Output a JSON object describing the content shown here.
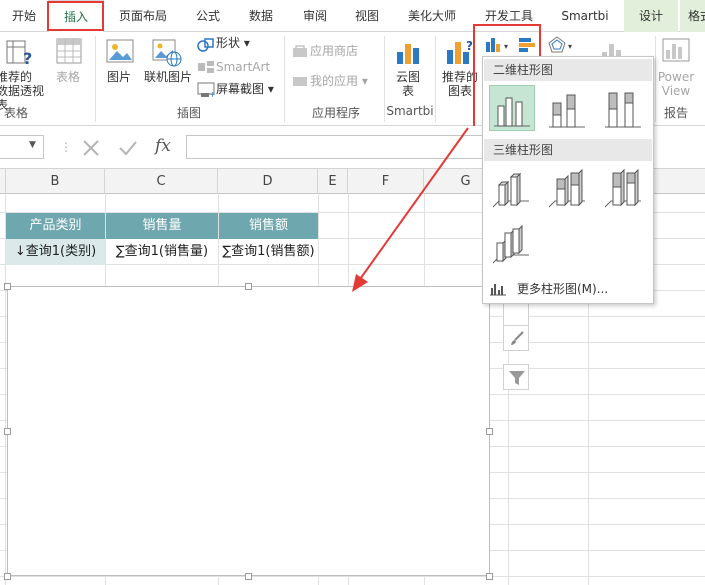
{
  "ribbon_tabs": [
    "开始",
    "插入",
    "页面布局",
    "公式",
    "数据",
    "审阅",
    "视图",
    "美化大师",
    "开发工具",
    "Smartbi",
    "设计",
    "格式"
  ],
  "active_tab": "插入",
  "ribbon": {
    "pivot_recommend": "推荐的\n数据透视表",
    "table": "表格",
    "group_tables": "表格",
    "picture": "图片",
    "online_picture": "联机图片",
    "shapes": "形状",
    "smartart": "SmartArt",
    "screenshot": "屏幕截图",
    "group_illustrations": "插图",
    "app_store": "应用商店",
    "my_apps": "我的应用",
    "group_apps": "应用程序",
    "cloud_chart": "云图\n表",
    "group_smartbi": "Smartbi",
    "recommended_charts": "推荐的\n图表",
    "power_view": "Power\nView",
    "group_reports": "报告"
  },
  "formula_bar": {
    "fx": "fx"
  },
  "columns": [
    "B",
    "C",
    "D",
    "E",
    "F",
    "G"
  ],
  "table": {
    "headers": [
      "产品类别",
      "销售量",
      "销售额"
    ],
    "row": [
      "↓查询1(类别)",
      "∑查询1(销售量)",
      "∑查询1(销售额)"
    ]
  },
  "dropdown": {
    "section_2d": "二维柱形图",
    "section_3d": "三维柱形图",
    "more": "更多柱形图(M)..."
  },
  "colors": {
    "accent": "#217346",
    "table_header": "#6fa7ae",
    "highlight": "#e53935",
    "selected": "#c6e5d2"
  }
}
